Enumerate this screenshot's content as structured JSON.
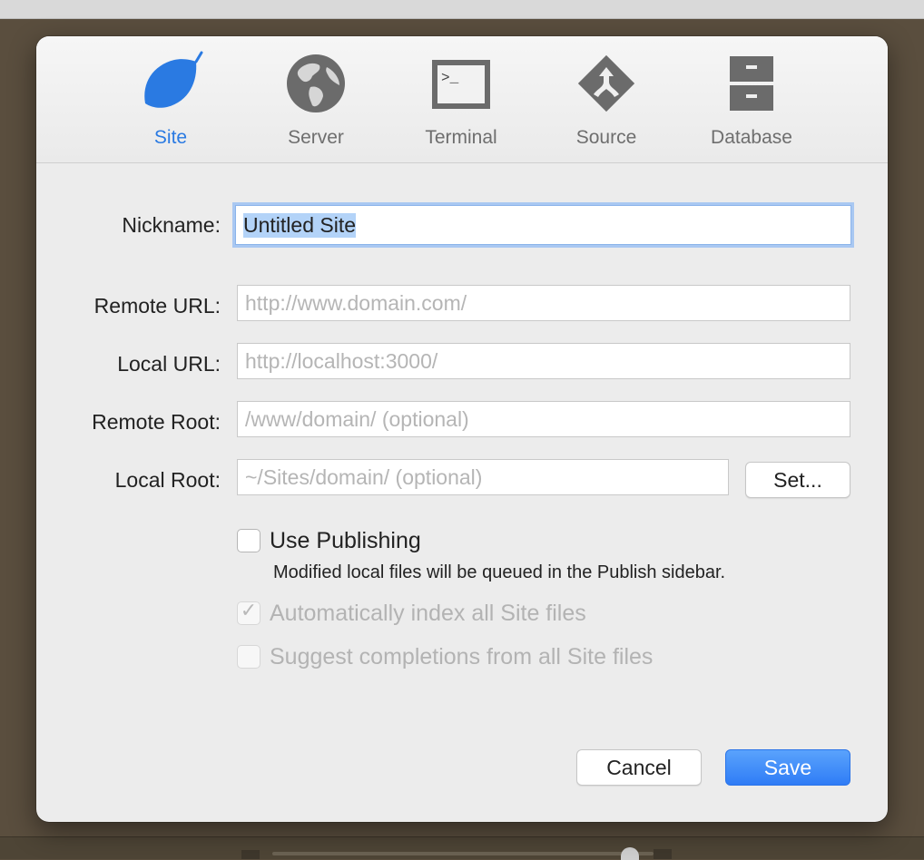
{
  "toolbar": {
    "tabs": [
      {
        "label": "Site",
        "icon": "leaf-icon",
        "active": true
      },
      {
        "label": "Server",
        "icon": "globe-icon",
        "active": false
      },
      {
        "label": "Terminal",
        "icon": "terminal-icon",
        "active": false
      },
      {
        "label": "Source",
        "icon": "source-branch-icon",
        "active": false
      },
      {
        "label": "Database",
        "icon": "database-cabinet-icon",
        "active": false
      }
    ],
    "terminal_prompt": ">_"
  },
  "form": {
    "nickname": {
      "label": "Nickname:",
      "value": "Untitled Site"
    },
    "remote_url": {
      "label": "Remote URL:",
      "value": "",
      "placeholder": "http://www.domain.com/"
    },
    "local_url": {
      "label": "Local URL:",
      "value": "",
      "placeholder": "http://localhost:3000/"
    },
    "remote_root": {
      "label": "Remote Root:",
      "value": "",
      "placeholder": "/www/domain/ (optional)"
    },
    "local_root": {
      "label": "Local Root:",
      "value": "",
      "placeholder": "~/Sites/domain/ (optional)",
      "set_button": "Set..."
    }
  },
  "options": {
    "use_publishing": {
      "label": "Use Publishing",
      "checked": false,
      "help": "Modified local files will be queued in the Publish sidebar."
    },
    "auto_index": {
      "label": "Automatically index all Site files",
      "checked": true,
      "disabled": true
    },
    "suggest_completions": {
      "label": "Suggest completions from all Site files",
      "checked": false,
      "disabled": true
    }
  },
  "buttons": {
    "cancel": "Cancel",
    "save": "Save"
  },
  "colors": {
    "accent": "#2a7ae2",
    "icon_gray": "#6b6b6b",
    "primary_button": "#2f7cf6"
  }
}
